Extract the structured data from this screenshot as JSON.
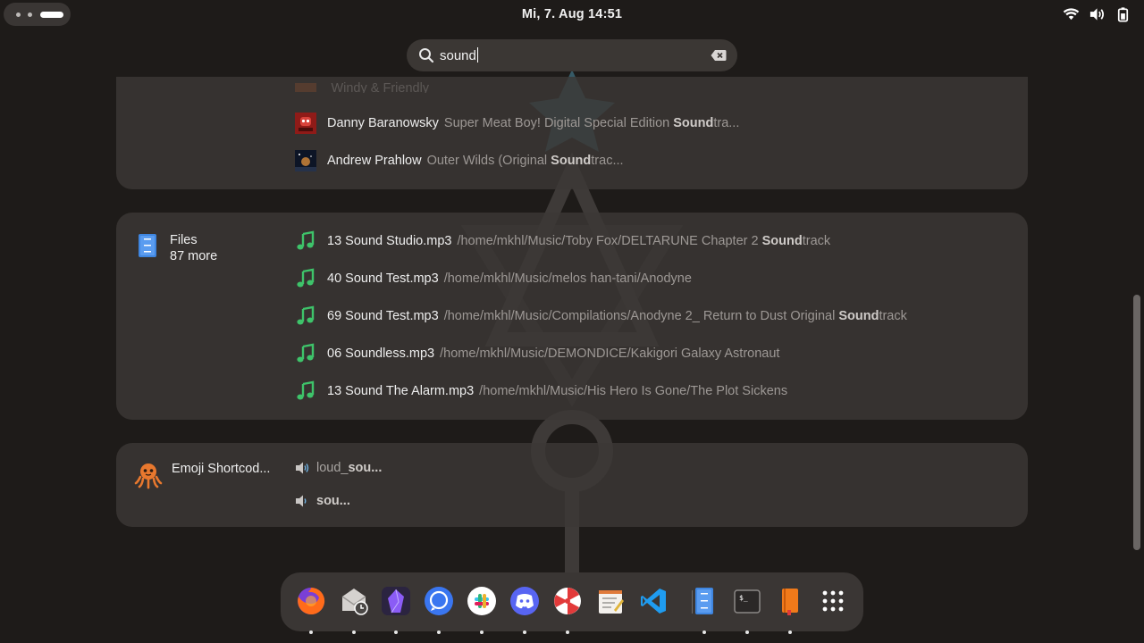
{
  "topbar": {
    "clock": "Mi, 7. Aug  14:51",
    "tray_icons": [
      "wifi-icon",
      "volume-icon",
      "battery-icon"
    ]
  },
  "search": {
    "value": "sound",
    "icon": "search-icon",
    "clear_icon": "clear-icon"
  },
  "music_results": {
    "faded_row": "Windy & Friendly",
    "rows": [
      {
        "title": "Danny Baranowsky",
        "desc_pre": "Super Meat Boy! Digital Special Edition ",
        "desc_bold": "Sound",
        "desc_post": "tra..."
      },
      {
        "title": "Andrew Prahlow",
        "desc_pre": "Outer Wilds (Original ",
        "desc_bold": "Sound",
        "desc_post": "trac..."
      }
    ]
  },
  "files_results": {
    "provider": "Files",
    "more": "87 more",
    "rows": [
      {
        "title": "13 Sound Studio.mp3",
        "desc_pre": "/home/mkhl/Music/Toby Fox/DELTARUNE Chapter 2 ",
        "desc_bold": "Sound",
        "desc_post": "track"
      },
      {
        "title": "40 Sound Test.mp3",
        "desc_pre": "/home/mkhl/Music/melos han-tani/Anodyne",
        "desc_bold": "",
        "desc_post": ""
      },
      {
        "title": "69 Sound Test.mp3",
        "desc_pre": "/home/mkhl/Music/Compilations/Anodyne 2_ Return to Dust Original ",
        "desc_bold": "Sound",
        "desc_post": "track"
      },
      {
        "title": "06 Soundless.mp3",
        "desc_pre": "/home/mkhl/Music/DEMONDICE/Kakigori Galaxy Astronaut",
        "desc_bold": "",
        "desc_post": ""
      },
      {
        "title": "13 Sound The Alarm.mp3",
        "desc_pre": "/home/mkhl/Music/His Hero Is Gone/The Plot Sickens",
        "desc_bold": "",
        "desc_post": ""
      }
    ]
  },
  "emoji_results": {
    "provider": "Emoji Shortcod...",
    "rows": [
      {
        "emoji": "🔊",
        "pre": "loud_",
        "bold": "sou..."
      },
      {
        "emoji": "🔉",
        "pre": "",
        "bold": "sou..."
      }
    ]
  },
  "dock": {
    "apps": [
      "firefox-icon",
      "mail-clock-icon",
      "obsidian-icon",
      "signal-icon",
      "slack-icon",
      "discord-icon",
      "peppermint-icon",
      "text-editor-icon",
      "vscode-icon",
      "files-icon",
      "terminal-icon",
      "books-icon",
      "app-grid-icon"
    ]
  }
}
